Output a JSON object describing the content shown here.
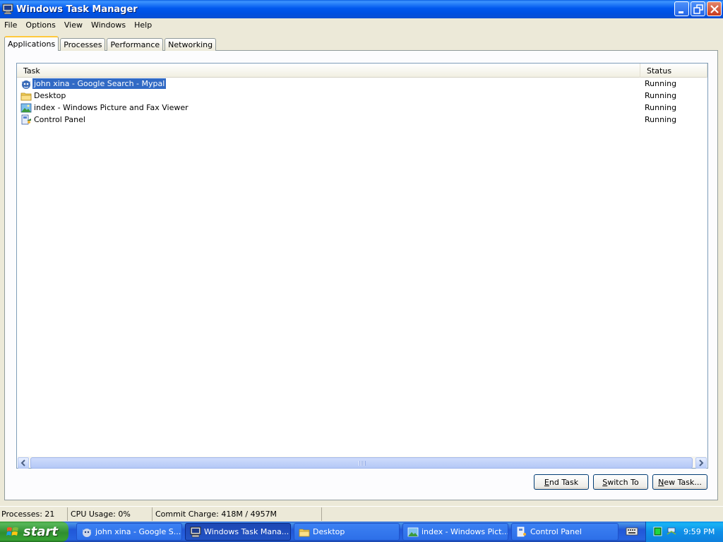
{
  "window": {
    "title": "Windows Task Manager"
  },
  "menu": [
    "File",
    "Options",
    "View",
    "Windows",
    "Help"
  ],
  "tabs": [
    {
      "label": "Applications",
      "active": true
    },
    {
      "label": "Processes",
      "active": false
    },
    {
      "label": "Performance",
      "active": false
    },
    {
      "label": "Networking",
      "active": false
    }
  ],
  "list": {
    "columns": {
      "task": "Task",
      "status": "Status"
    },
    "rows": [
      {
        "name": "john xina - Google Search - Mypal",
        "status": "Running",
        "icon": "mypal-icon",
        "selected": true
      },
      {
        "name": "Desktop",
        "status": "Running",
        "icon": "folder-icon",
        "selected": false
      },
      {
        "name": "index - Windows Picture and Fax Viewer",
        "status": "Running",
        "icon": "picture-viewer-icon",
        "selected": false
      },
      {
        "name": "Control Panel",
        "status": "Running",
        "icon": "control-panel-icon",
        "selected": false
      }
    ]
  },
  "buttons": {
    "end_task": {
      "mnemonic": "E",
      "rest": "nd Task"
    },
    "switch_to": {
      "mnemonic": "S",
      "rest": "witch To"
    },
    "new_task": {
      "mnemonic": "N",
      "rest": "ew Task..."
    }
  },
  "status": {
    "processes": "Processes: 21",
    "cpu": "CPU Usage: 0%",
    "commit": "Commit Charge: 418M / 4957M"
  },
  "taskbar": {
    "start_label": "start",
    "items": [
      {
        "label": "john xina - Google S...",
        "icon": "mypal-icon",
        "active": false
      },
      {
        "label": "Windows Task Mana...",
        "icon": "task-manager-icon",
        "active": true
      },
      {
        "label": "Desktop",
        "icon": "folder-icon",
        "active": false
      },
      {
        "label": "index - Windows Pict...",
        "icon": "picture-viewer-icon",
        "active": false
      },
      {
        "label": "Control Panel",
        "icon": "control-panel-icon",
        "active": false
      }
    ],
    "clock": "9:59 PM"
  }
}
